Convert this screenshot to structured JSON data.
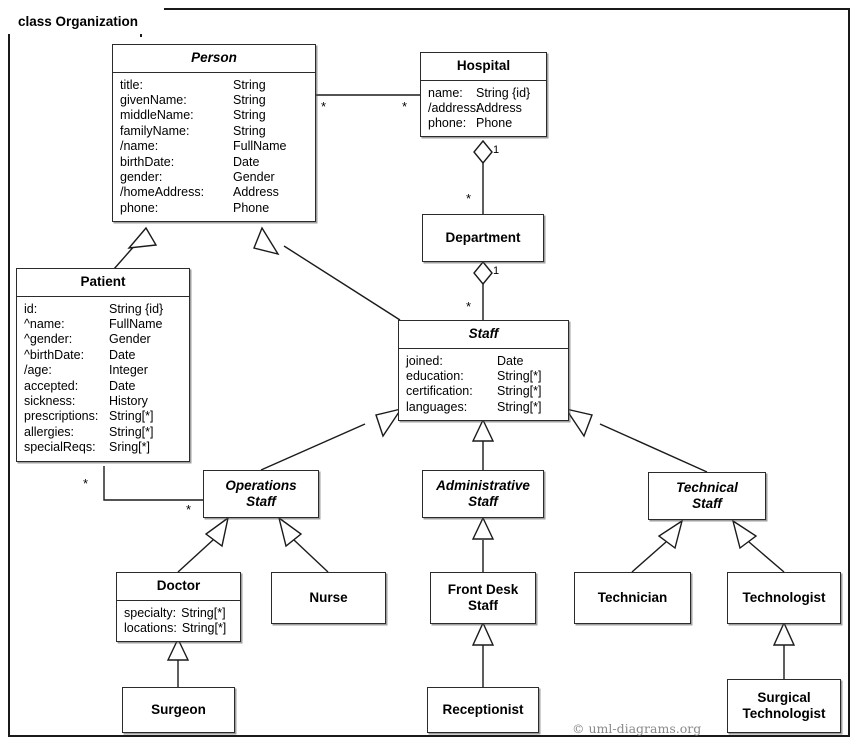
{
  "frame": {
    "label": "class Organization"
  },
  "credit": {
    "text": "© uml-diagrams.org"
  },
  "classes": {
    "person": {
      "name": "Person",
      "abstract": true,
      "attributes": [
        {
          "name": "title:",
          "type": "String"
        },
        {
          "name": "givenName:",
          "type": "String"
        },
        {
          "name": "middleName:",
          "type": "String"
        },
        {
          "name": "familyName:",
          "type": "String"
        },
        {
          "name": "/name:",
          "type": "FullName"
        },
        {
          "name": "birthDate:",
          "type": "Date"
        },
        {
          "name": "gender:",
          "type": "Gender"
        },
        {
          "name": "/homeAddress:",
          "type": "Address"
        },
        {
          "name": "phone:",
          "type": "Phone"
        }
      ]
    },
    "hospital": {
      "name": "Hospital",
      "abstract": false,
      "attributes": [
        {
          "name": "name:",
          "type": "String {id}"
        },
        {
          "name": "/address:",
          "type": "Address"
        },
        {
          "name": "phone:",
          "type": "Phone"
        }
      ]
    },
    "department": {
      "name": "Department",
      "abstract": false,
      "attributes": []
    },
    "staff": {
      "name": "Staff",
      "abstract": true,
      "attributes": [
        {
          "name": "joined:",
          "type": "Date"
        },
        {
          "name": "education:",
          "type": "String[*]"
        },
        {
          "name": "certification:",
          "type": "String[*]"
        },
        {
          "name": "languages:",
          "type": "String[*]"
        }
      ]
    },
    "patient": {
      "name": "Patient",
      "abstract": false,
      "attributes": [
        {
          "name": "id:",
          "type": "String {id}"
        },
        {
          "name": "^name:",
          "type": "FullName"
        },
        {
          "name": "^gender:",
          "type": "Gender"
        },
        {
          "name": "^birthDate:",
          "type": "Date"
        },
        {
          "name": "/age:",
          "type": "Integer"
        },
        {
          "name": "accepted:",
          "type": "Date"
        },
        {
          "name": "sickness:",
          "type": "History"
        },
        {
          "name": "prescriptions:",
          "type": "String[*]"
        },
        {
          "name": "allergies:",
          "type": "String[*]"
        },
        {
          "name": "specialReqs:",
          "type": "Sring[*]"
        }
      ]
    },
    "operations_staff": {
      "name": "Operations\nStaff",
      "abstract": true,
      "attributes": []
    },
    "administrative_staff": {
      "name": "Administrative\nStaff",
      "abstract": true,
      "attributes": []
    },
    "technical_staff": {
      "name": "Technical\nStaff",
      "abstract": true,
      "attributes": []
    },
    "doctor": {
      "name": "Doctor",
      "abstract": false,
      "attributes": [
        {
          "name": "specialty:",
          "type": "String[*]"
        },
        {
          "name": "locations:",
          "type": "String[*]"
        }
      ]
    },
    "nurse": {
      "name": "Nurse",
      "abstract": false,
      "attributes": []
    },
    "front_desk_staff": {
      "name": "Front Desk\nStaff",
      "abstract": false,
      "attributes": []
    },
    "technician": {
      "name": "Technician",
      "abstract": false,
      "attributes": []
    },
    "technologist": {
      "name": "Technologist",
      "abstract": false,
      "attributes": []
    },
    "surgeon": {
      "name": "Surgeon",
      "abstract": false,
      "attributes": []
    },
    "receptionist": {
      "name": "Receptionist",
      "abstract": false,
      "attributes": []
    },
    "surgical_technologist": {
      "name": "Surgical\nTechnologist",
      "abstract": false,
      "attributes": []
    }
  },
  "multiplicities": {
    "person_hospital_source": "*",
    "person_hospital_target": "*",
    "hospital_department_one": "1",
    "hospital_department_many": "*",
    "department_staff_one": "1",
    "department_staff_many": "*",
    "patient_operations_source": "*",
    "patient_operations_target": "*"
  },
  "relationships": [
    {
      "kind": "association",
      "from": "person",
      "to": "hospital"
    },
    {
      "kind": "aggregation",
      "from": "hospital",
      "to": "department"
    },
    {
      "kind": "aggregation",
      "from": "department",
      "to": "staff"
    },
    {
      "kind": "association",
      "from": "patient",
      "to": "operations_staff"
    },
    {
      "kind": "generalization",
      "from": "patient",
      "to": "person"
    },
    {
      "kind": "generalization",
      "from": "staff",
      "to": "person"
    },
    {
      "kind": "generalization",
      "from": "operations_staff",
      "to": "staff"
    },
    {
      "kind": "generalization",
      "from": "administrative_staff",
      "to": "staff"
    },
    {
      "kind": "generalization",
      "from": "technical_staff",
      "to": "staff"
    },
    {
      "kind": "generalization",
      "from": "doctor",
      "to": "operations_staff"
    },
    {
      "kind": "generalization",
      "from": "nurse",
      "to": "operations_staff"
    },
    {
      "kind": "generalization",
      "from": "front_desk_staff",
      "to": "administrative_staff"
    },
    {
      "kind": "generalization",
      "from": "technician",
      "to": "technical_staff"
    },
    {
      "kind": "generalization",
      "from": "technologist",
      "to": "technical_staff"
    },
    {
      "kind": "generalization",
      "from": "surgeon",
      "to": "doctor"
    },
    {
      "kind": "generalization",
      "from": "receptionist",
      "to": "front_desk_staff"
    },
    {
      "kind": "generalization",
      "from": "surgical_technologist",
      "to": "technologist"
    }
  ],
  "colors": {
    "background": "#ffffff",
    "line": "#1a1a1a",
    "box_border": "#2b2b2b",
    "text": "#000000",
    "credit_text": "#8a8a8a"
  }
}
